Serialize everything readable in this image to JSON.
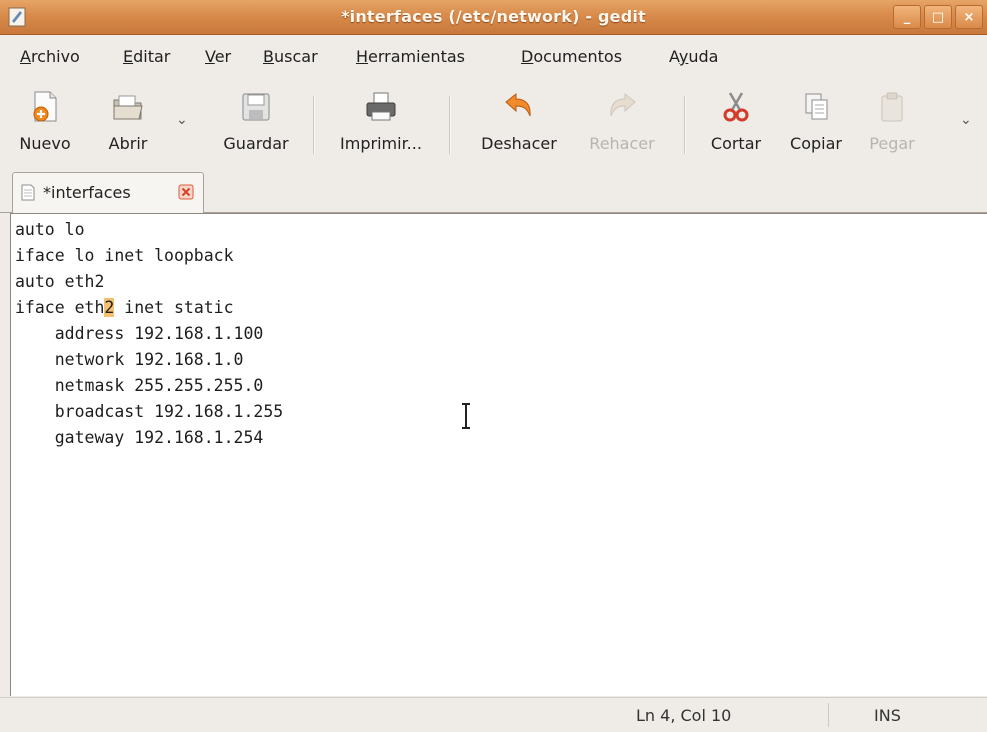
{
  "window": {
    "title": "*interfaces (/etc/network) - gedit",
    "controls": {
      "minimize": "_",
      "maximize": "□",
      "close": "×"
    },
    "accent": "#d88b4b"
  },
  "menubar": {
    "items": [
      {
        "key": "A",
        "rest": "rchivo"
      },
      {
        "key": "E",
        "rest": "ditar"
      },
      {
        "key": "V",
        "rest": "er"
      },
      {
        "key": "B",
        "rest": "uscar"
      },
      {
        "key": "H",
        "rest": "erramientas"
      },
      {
        "key": "D",
        "rest": "ocumentos"
      },
      {
        "pre": "A",
        "key": "y",
        "rest": "uda"
      }
    ]
  },
  "toolbar": {
    "new_label": "Nuevo",
    "open_label": "Abrir",
    "save_label": "Guardar",
    "print_label": "Imprimir...",
    "undo_label": "Deshacer",
    "redo_label": "Rehacer",
    "cut_label": "Cortar",
    "copy_label": "Copiar",
    "paste_label": "Pegar",
    "icons": [
      "new-document-icon",
      "open-folder-icon",
      "save-icon",
      "printer-icon",
      "undo-icon",
      "redo-icon",
      "scissors-icon",
      "copy-icon",
      "paste-icon"
    ]
  },
  "tabs": [
    {
      "label": "*interfaces",
      "icon": "text-document-icon"
    }
  ],
  "editor": {
    "lines": [
      "auto lo",
      "iface lo inet loopback",
      "auto eth2",
      {
        "before": "iface eth",
        "highlight": "2",
        "after": " inet static"
      },
      "    address 192.168.1.100",
      "    network 192.168.1.0",
      "    netmask 255.255.255.0",
      "    broadcast 192.168.1.255",
      "    gateway 192.168.1.254"
    ],
    "highlight_color": "#f4c070"
  },
  "statusbar": {
    "position": "Ln 4, Col 10",
    "mode": "INS"
  }
}
